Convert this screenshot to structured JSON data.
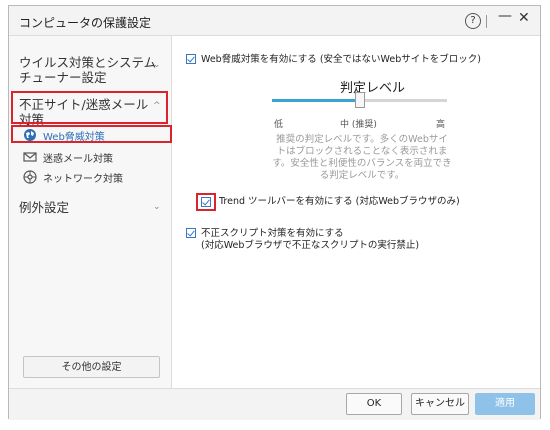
{
  "window": {
    "title": "コンピュータの保護設定",
    "help_icon": "?"
  },
  "sidebar": {
    "items": [
      {
        "label": "ウイルス対策とシステム\nチューナー設定",
        "expanded": false
      },
      {
        "label": "不正サイト/迷惑メール\n対策",
        "expanded": true
      },
      {
        "label": "例外設定",
        "expanded": false
      }
    ],
    "subitems": [
      {
        "label": "Web脅威対策",
        "icon": "globe-icon",
        "selected": true
      },
      {
        "label": "迷惑メール対策",
        "icon": "mail-icon",
        "selected": false
      },
      {
        "label": "ネットワーク対策",
        "icon": "network-icon",
        "selected": false
      }
    ],
    "other_settings_label": "その他の設定"
  },
  "content": {
    "web_threat_option": {
      "label": "Web脅威対策を有効にする (安全ではないWebサイトをブロック)",
      "checked": true
    },
    "level": {
      "title": "判定レベル",
      "ticks": [
        "低",
        "中 (推奨)",
        "高"
      ],
      "value": 0.5,
      "description": "推奨の判定レベルです。多くのWebサイトはブロックされることなく表示されます。安全性と利便性のバランスを両立できる判定レベルです。"
    },
    "trend_option": {
      "label": "Trend ツールバーを有効にする (対応Webブラウザのみ)",
      "checked": true
    },
    "script_option": {
      "line1": "不正スクリプト対策を有効にする",
      "line2": "(対応Webブラウザで不正なスクリプトの実行禁止)",
      "checked": true
    }
  },
  "footer": {
    "ok": "OK",
    "cancel": "キャンセル",
    "apply": "適用"
  },
  "colors": {
    "accent": "#3aa3d6",
    "highlight": "#d9232d",
    "apply_disabled": "#8fc2e8",
    "selected_text": "#2b6fb7"
  }
}
